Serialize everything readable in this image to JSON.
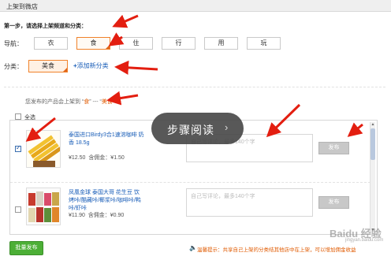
{
  "window": {
    "title": "上架到微店"
  },
  "step1": {
    "text": "第一步，请选择上架频道和分类："
  },
  "nav": {
    "label": "导航：",
    "items": [
      "衣",
      "食",
      "住",
      "行",
      "用",
      "玩"
    ],
    "selected": "食"
  },
  "category": {
    "label": "分类：",
    "selected": "美食",
    "add_label": "添加新分类"
  },
  "publish_info": {
    "prefix": "您发布的产品会上架到 “",
    "channel": "食",
    "sep": "” --- “",
    "category": "美食",
    "suffix": "”"
  },
  "select_all": {
    "label": "全选",
    "checked": false
  },
  "products": [
    {
      "title": "泰国进口Birdy3合1速溶咖啡 奶香 18.5g",
      "price": "¥12.50",
      "commission": "含佣金：¥1.50",
      "checked": true,
      "review_placeholder": "自己写评论，最多140个字",
      "publish_label": "发布"
    },
    {
      "title": "凤凰金球 泰国大哥 花生豆 饮烤咔/酷藏咔/椰浆咔/咖啡咔/鸭咔/虾咔",
      "price": "¥11.90",
      "commission": "含佣金：¥0.90",
      "checked": false,
      "review_placeholder": "自己写评论，最多140个字",
      "publish_label": "发布"
    }
  ],
  "footer": {
    "bulk_publish": "批量发布",
    "tip": "温馨提示：共享自己上架的分类结其他店中在上架，可以增加佣金收益"
  },
  "overlay": {
    "text": "步骤阅读",
    "chevron": "›"
  },
  "watermark": {
    "brand": "Baidu 经验",
    "url": "jingyan.baidu.com"
  },
  "colors": {
    "accent": "#f0822b",
    "link": "#1a5eb8",
    "green": "#4caf36",
    "arrow": "#e31e10"
  }
}
